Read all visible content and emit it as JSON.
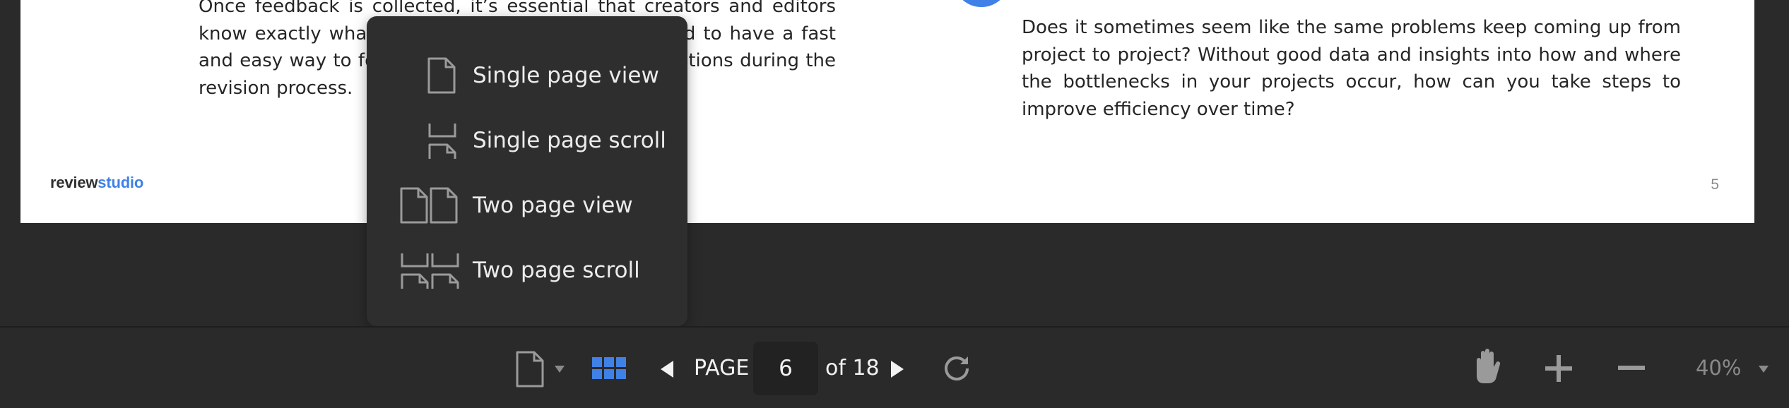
{
  "document": {
    "left_paragraph": "Once feedback is collected, it’s essential that creators and editors know exactly what to do with it. Review teams need to have a fast and easy way to follow up on comments and suggestions during the revision process.",
    "right_paragraph": "Does it sometimes seem like the same problems keep coming up from project to project? Without good data and insights into how and where the bottlenecks in your projects occur, how can you take steps to improve efficiency over time?",
    "logo": {
      "part1": "review",
      "part2": "studio"
    },
    "page_number": "5"
  },
  "view_menu": {
    "items": [
      {
        "label": "Single page view",
        "icon": "single-page-view-icon"
      },
      {
        "label": "Single page scroll",
        "icon": "single-page-scroll-icon"
      },
      {
        "label": "Two page view",
        "icon": "two-page-view-icon"
      },
      {
        "label": "Two page scroll",
        "icon": "two-page-scroll-icon"
      }
    ]
  },
  "toolbar": {
    "page_label": "PAGE",
    "current_page": "6",
    "of_label": "of 18",
    "zoom": "40%"
  },
  "colors": {
    "accent": "#3f81e6",
    "background": "#2a2a2a",
    "menu_bg": "#2e2e2e",
    "icon_gray": "#9a9a9a"
  }
}
